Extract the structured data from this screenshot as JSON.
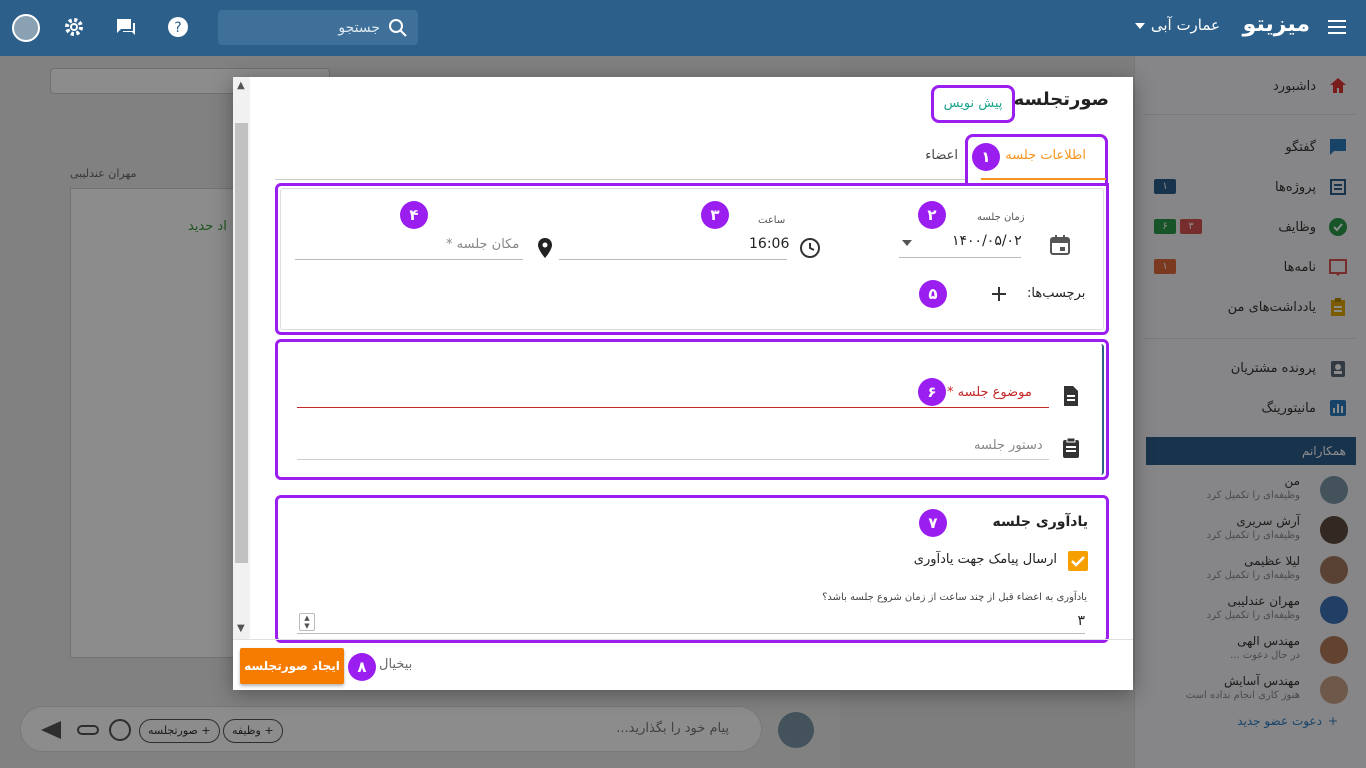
{
  "topbar": {
    "brand": "میزیتو",
    "workspace": "عمارت آبی",
    "search_placeholder": "جستجو"
  },
  "sidebar": {
    "items": [
      {
        "label": "داشبورد",
        "icon": "home-icon",
        "color": "#d33"
      },
      {
        "label": "گفتگو",
        "icon": "chat-icon",
        "color": "#2c7bbf"
      },
      {
        "label": "پروژه‌ها",
        "icon": "projects-icon",
        "color": "#2c5f8a",
        "badges": [
          {
            "text": "۱",
            "color": "#2c5f8a"
          }
        ]
      },
      {
        "label": "وظایف",
        "icon": "tasks-icon",
        "color": "#2a9a4a",
        "badges": [
          {
            "text": "۶",
            "color": "#2a9a4a"
          },
          {
            "text": "۳",
            "color": "#d9534f"
          }
        ]
      },
      {
        "label": "نامه‌ها",
        "icon": "letters-icon",
        "color": "#d9534f",
        "badges": [
          {
            "text": "۱",
            "color": "#e06a3a"
          }
        ]
      },
      {
        "label": "یادداشت‌های من",
        "icon": "notes-icon",
        "color": "#e0a800"
      },
      {
        "label": "پرونده مشتریان",
        "icon": "customers-icon",
        "color": "#5a6b7a"
      },
      {
        "label": "مانیتورینگ",
        "icon": "monitoring-icon",
        "color": "#2c7bbf"
      }
    ],
    "colleagues_title": "همکارانم",
    "colleagues": [
      {
        "name": "من",
        "status": "وظیفه‌ای را تکمیل کرد"
      },
      {
        "name": "آرش سریری",
        "status": "وظیفه‌ای را تکمیل کرد"
      },
      {
        "name": "لیلا عظیمی",
        "status": "وظیفه‌ای را تکمیل کرد"
      },
      {
        "name": "مهران عندلیبی",
        "status": "وظیفه‌ای را تکمیل کرد"
      },
      {
        "name": "مهندس الهی",
        "status": "در حال دعوت ..."
      },
      {
        "name": "مهندس آسایش",
        "status": "هنوز کاری انجام نداده است"
      }
    ],
    "invite": "دعوت عضو جدید"
  },
  "background": {
    "doc_author": "مهران عندلیبی",
    "doc_text": "اد حدید",
    "composer_placeholder": "پیام خود را بگذارید...",
    "chip_task": "+ وظیفه",
    "chip_minutes": "+ صورتجلسه"
  },
  "modal": {
    "title": "صورتجلسه",
    "draft": "پیش نویس",
    "tabs": {
      "info": "اطلاعات جلسه",
      "members": "اعضاء"
    },
    "date": {
      "label": "زمان جلسه",
      "value": "۱۴۰۰/۰۵/۰۲"
    },
    "time": {
      "label": "ساعت",
      "value": "16:06"
    },
    "location_placeholder": "مکان جلسه *",
    "tags_label": "برچسب‌ها:",
    "subject_placeholder": "موضوع جلسه *",
    "agenda_placeholder": "دستور جلسه",
    "reminder": {
      "title": "یادآوری جلسه",
      "sms_label": "ارسال پیامک جهت یادآوری",
      "hours_label": "یادآوری به اعضاء قبل از چند ساعت از زمان شروع جلسه باشد؟",
      "hours_value": "۳"
    },
    "create_button": "ایجاد صورتجلسه",
    "cancel_button": "بیخیال",
    "badges": [
      "۱",
      "۲",
      "۳",
      "۴",
      "۵",
      "۶",
      "۷",
      "۸"
    ],
    "accent_purple": "#9b1ef0",
    "accent_orange": "#f57c00"
  }
}
